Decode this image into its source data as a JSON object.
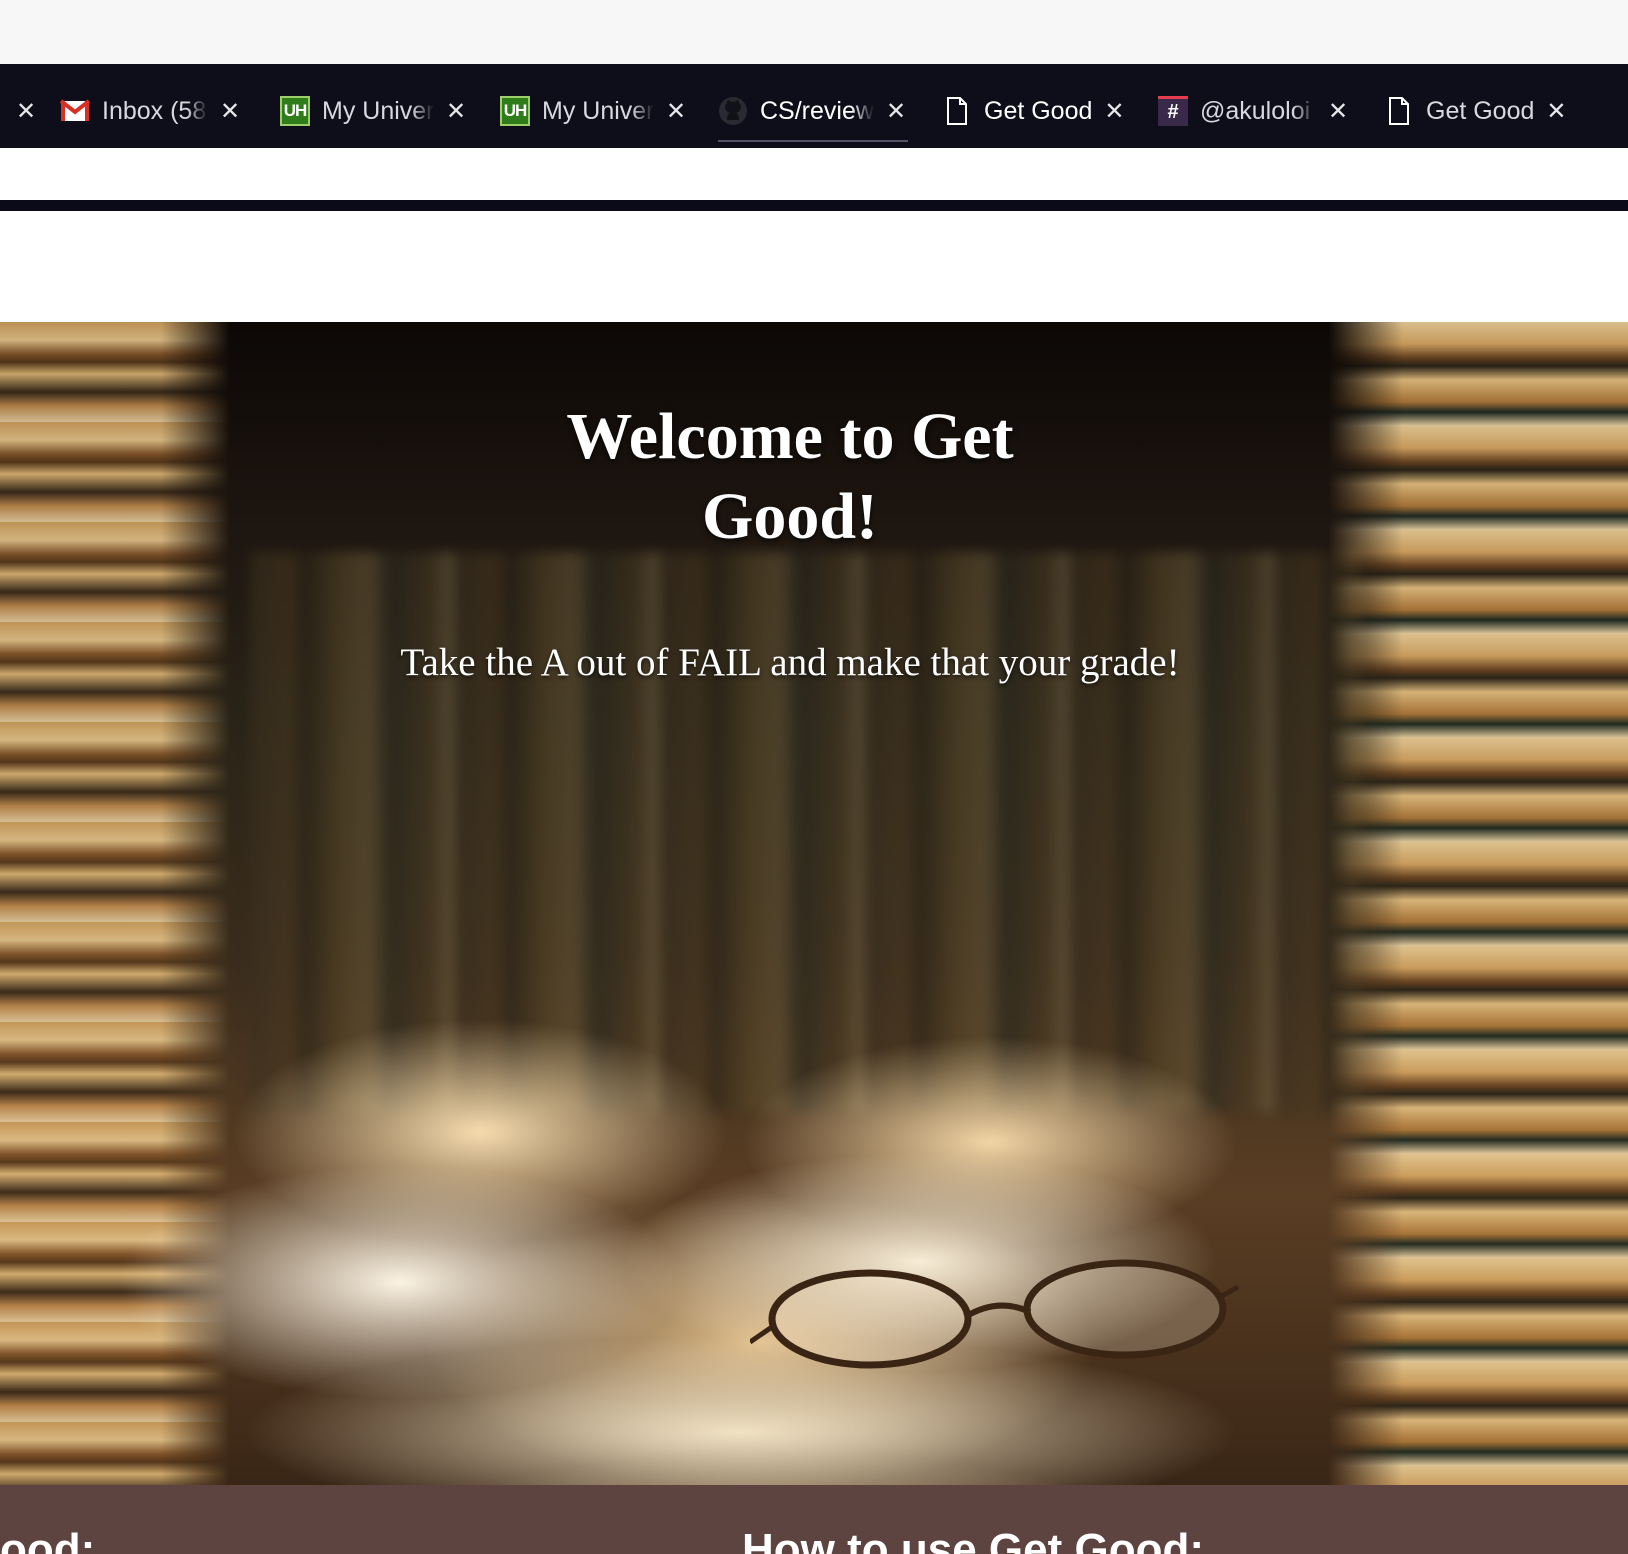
{
  "browser": {
    "tabs": [
      {
        "title": "",
        "icon": "none",
        "active": false
      },
      {
        "title": "Inbox (58",
        "icon": "gmail-icon",
        "active": false
      },
      {
        "title": "My Univer",
        "icon": "uh-icon",
        "icon_text": "UH",
        "active": false
      },
      {
        "title": "My Univer",
        "icon": "uh-icon",
        "icon_text": "UH",
        "active": false
      },
      {
        "title": "CS/review",
        "icon": "github-icon",
        "active": true
      },
      {
        "title": "Get Good",
        "icon": "page-icon",
        "active": false
      },
      {
        "title": "@akuloloi",
        "icon": "slack-icon",
        "icon_text": "#",
        "active": false
      },
      {
        "title": "Get Good",
        "icon": "page-icon",
        "active": false
      }
    ],
    "close_glyph": "✕"
  },
  "hero": {
    "title_line1": "Welcome to Get",
    "title_line2": "Good!",
    "subtitle": "Take the A out of FAIL and make that your grade!"
  },
  "footer": {
    "heading_left": "ood:",
    "heading_right": "How to use Get Good:"
  },
  "colors": {
    "tabstrip_bg": "#0e0e1a",
    "footer_bg": "#5e4440",
    "uh_green": "#2e7d1a",
    "gmail_red": "#d93025"
  }
}
